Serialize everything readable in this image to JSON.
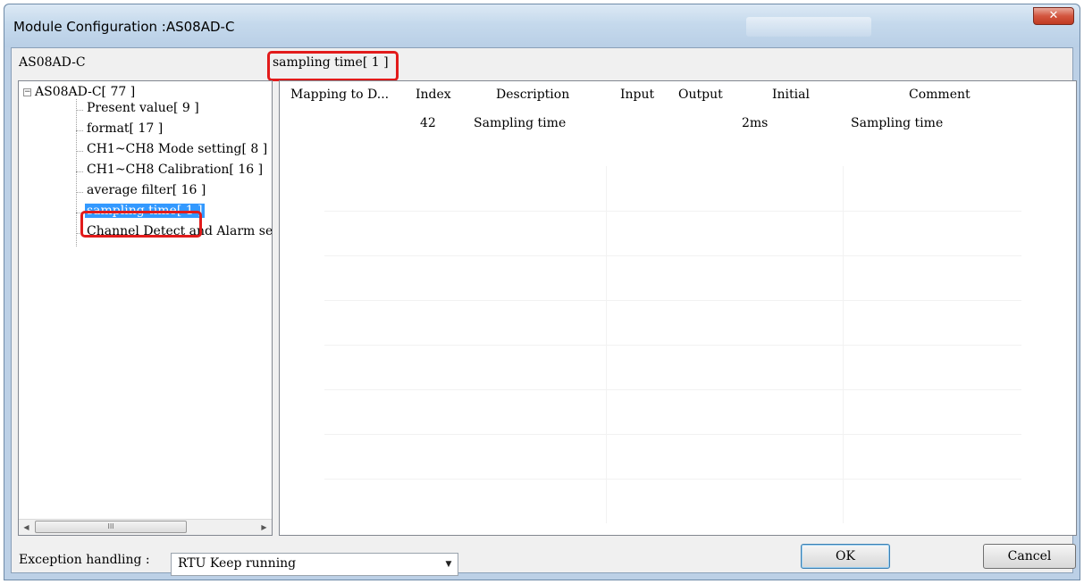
{
  "window": {
    "title": "Module Configuration :AS08AD-C",
    "close_glyph": "✕"
  },
  "module_label": "AS08AD-C",
  "section_label": "sampling time[ 1 ]",
  "tree": {
    "root_label": "AS08AD-C[ 77 ]",
    "expander_glyph": "−",
    "items": [
      {
        "label": "Present value[ 9 ]"
      },
      {
        "label": "format[ 17 ]"
      },
      {
        "label": "CH1~CH8 Mode setting[ 8 ]"
      },
      {
        "label": "CH1~CH8 Calibration[ 16 ]"
      },
      {
        "label": "average filter[ 16 ]"
      },
      {
        "label": "sampling time[ 1 ]"
      },
      {
        "label": "Channel Detect and Alarm se"
      }
    ],
    "selected_index": 5,
    "scroll_left_glyph": "◀",
    "scroll_right_glyph": "▶",
    "scroll_thumb_glyph": "III"
  },
  "grid": {
    "columns": [
      "Mapping to D...",
      "Index",
      "Description",
      "Input",
      "Output",
      "Initial",
      "Comment"
    ],
    "rows": [
      {
        "mapping": "",
        "index": "42",
        "description": "Sampling time",
        "input": "",
        "output": "",
        "initial": "2ms",
        "comment": "Sampling time"
      }
    ]
  },
  "exception": {
    "label": "Exception handling :",
    "value": "RTU Keep running",
    "arrow_glyph": "▼"
  },
  "buttons": {
    "ok": "OK",
    "cancel": "Cancel"
  },
  "colors": {
    "selection": "#3399ff",
    "highlight": "#e21b1b",
    "title_bar": "#c5d9ec"
  },
  "icons": [
    "close-icon",
    "tree-collapse-icon",
    "scroll-left-icon",
    "scroll-right-icon",
    "dropdown-arrow-icon"
  ]
}
